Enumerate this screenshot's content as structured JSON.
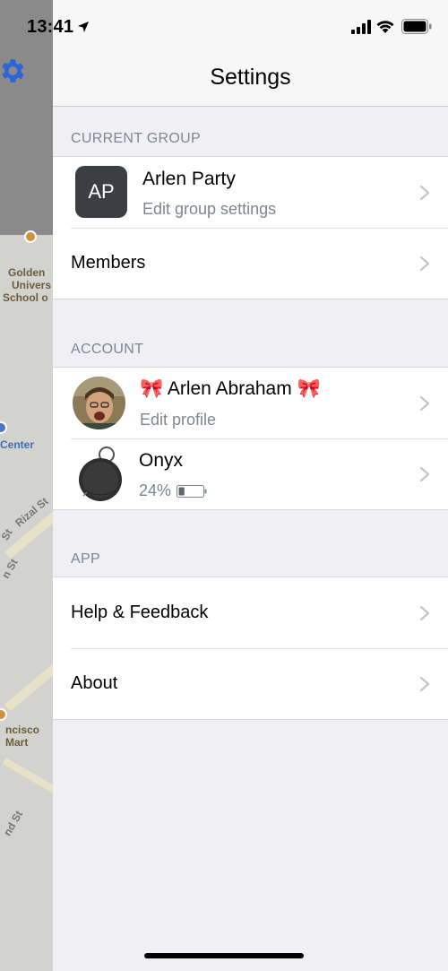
{
  "status_bar": {
    "time": "13:41",
    "icons": [
      "location-arrow-icon",
      "cellular-signal-icon",
      "wifi-icon",
      "battery-icon"
    ]
  },
  "map_background": {
    "labels": [
      "Golden",
      "Univers",
      "School o",
      "Center",
      "Rizal St",
      "St",
      "n St",
      "ncisco",
      "Mart",
      "nd St"
    ]
  },
  "nav": {
    "title": "Settings"
  },
  "sections": {
    "current_group": {
      "header": "CURRENT GROUP",
      "group": {
        "initials": "AP",
        "name": "Arlen Party",
        "subtitle": "Edit group settings"
      },
      "members_label": "Members"
    },
    "account": {
      "header": "ACCOUNT",
      "profile": {
        "name": "🎀 Arlen Abraham 🎀",
        "subtitle": "Edit profile"
      },
      "device": {
        "name": "Onyx",
        "battery": "24%",
        "battery_level": 0.24
      }
    },
    "app": {
      "header": "APP",
      "items": [
        "Help & Feedback",
        "About"
      ]
    }
  },
  "colors": {
    "accent": "#2a66d8",
    "secondary_text": "#7d8694",
    "background": "#efeff4"
  }
}
